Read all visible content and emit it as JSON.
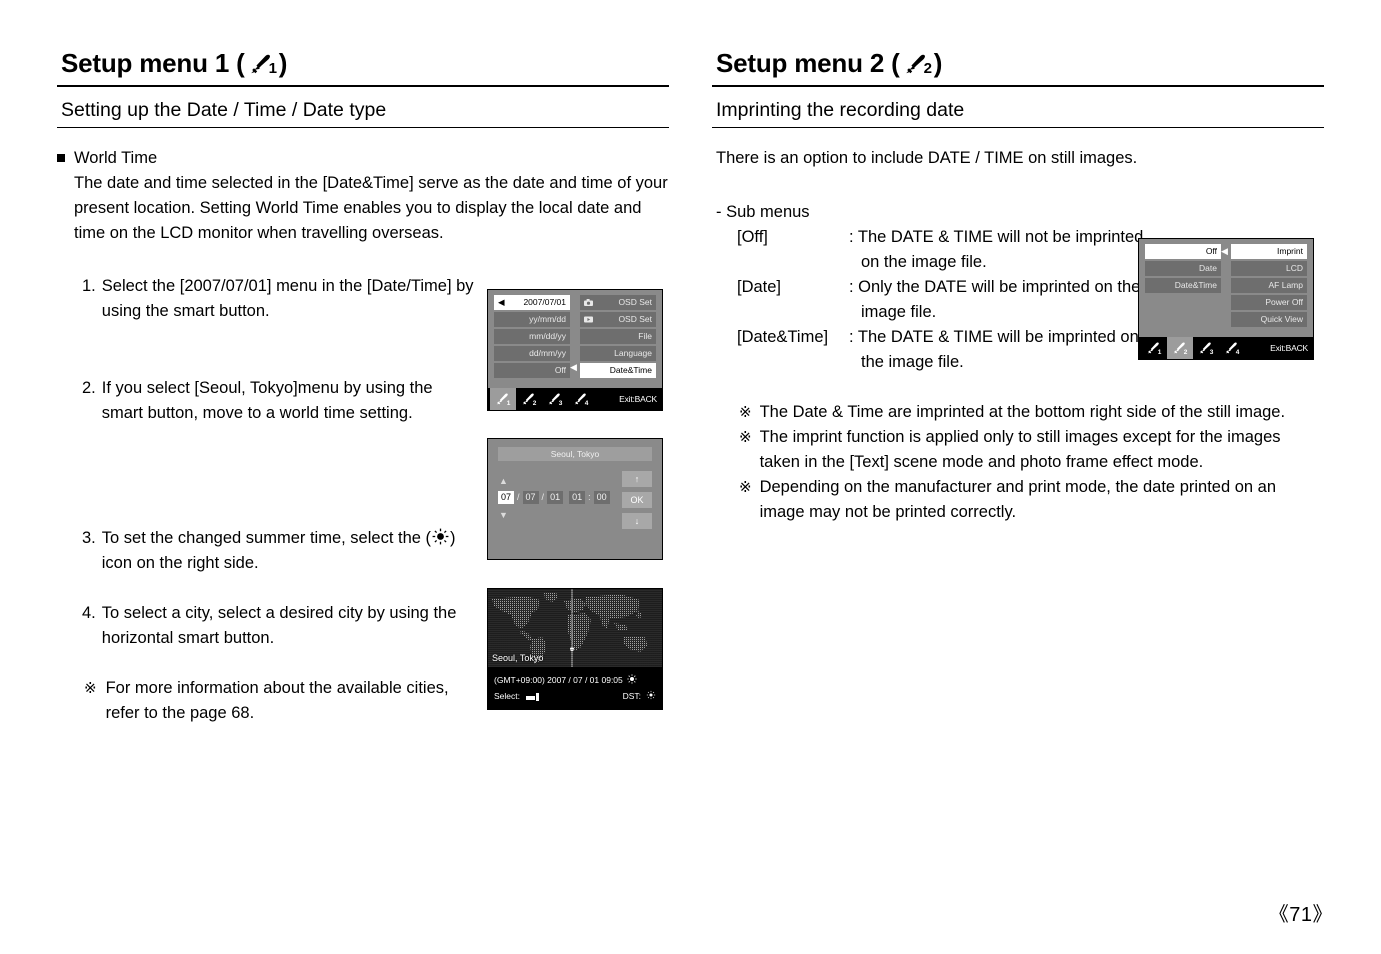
{
  "page": {
    "number": "《71》"
  },
  "left": {
    "chapter_title": "Setup menu 1 (",
    "chapter_title_close": ")",
    "wrench_sub": "1",
    "section_title": "Setting up the Date / Time / Date type",
    "bullet_heading": "World Time",
    "paragraph": "The date and time selected in the [Date&Time] serve as the date and time of your present location. Setting World Time enables you to display the local date and time on the LCD monitor when travelling overseas.",
    "steps": [
      {
        "num": "1.",
        "text": "Select the [2007/07/01] menu in the [Date/Time] by using the smart button."
      },
      {
        "num": "2.",
        "text": "If you select [Seoul, Tokyo]menu by using the smart button, move to a world time setting."
      },
      {
        "num": "3.",
        "text_before": "To set the changed summer time, select the (",
        "text_after": ") icon on the right side.",
        "icon": "sun-icon"
      },
      {
        "num": "4.",
        "text": "To select a city, select a desired city by using the horizontal smart button."
      }
    ],
    "note": {
      "mark": "※",
      "text": "For more information about the available cities, refer to the page 68."
    }
  },
  "right": {
    "chapter_title": "Setup menu 2 (",
    "chapter_title_close": ")",
    "wrench_sub": "2",
    "section_title": "Imprinting the recording date",
    "intro": "There is an option to include DATE / TIME on still images.",
    "submenus_label": "- Sub menus",
    "submenus": [
      {
        "key": "[Off]",
        "value": ": The DATE & TIME will not be imprinted",
        "cont": "on the image file."
      },
      {
        "key": "[Date]",
        "value": ": Only the DATE will be imprinted on the",
        "cont": "image file."
      },
      {
        "key": "[Date&Time]",
        "value": ": The DATE & TIME will be imprinted on",
        "cont": "the image file."
      }
    ],
    "notes": [
      {
        "mark": "※",
        "text": "The Date & Time are imprinted at the bottom right side of the still image."
      },
      {
        "mark": "※",
        "text": "The imprint function is applied only to still images except for the images taken in the [Text] scene mode and photo frame effect mode."
      },
      {
        "mark": "※",
        "text": "Depending on the manufacturer and print mode, the date printed on an image may not be printed correctly."
      }
    ]
  },
  "lcd_setup1": {
    "left_items": [
      {
        "label": "2007/07/01",
        "selected": true,
        "lead_arrow": "◀"
      },
      {
        "label": "yy/mm/dd",
        "selected": false
      },
      {
        "label": "mm/dd/yy",
        "selected": false
      },
      {
        "label": "dd/mm/yy",
        "selected": false
      },
      {
        "label": "Off",
        "selected": false
      }
    ],
    "right_items": [
      {
        "label": "OSD Set",
        "selected": false,
        "icon": "camera-icon"
      },
      {
        "label": "OSD Set",
        "selected": false,
        "icon": "play-icon"
      },
      {
        "label": "File",
        "selected": false
      },
      {
        "label": "Language",
        "selected": false
      },
      {
        "label": "Date&Time",
        "selected": true,
        "pointer": "◀"
      }
    ],
    "tabs": [
      {
        "sub": "1",
        "active": true
      },
      {
        "sub": "2",
        "active": false
      },
      {
        "sub": "3",
        "active": false
      },
      {
        "sub": "4",
        "active": false
      }
    ],
    "exit": "Exit:BACK"
  },
  "lcd_worldtime": {
    "city": "Seoul, Tokyo",
    "fields": [
      {
        "value": "07",
        "selected": true
      },
      {
        "value": "07",
        "selected": false
      },
      {
        "value": "01",
        "selected": false
      },
      {
        "value": "01",
        "selected": false
      },
      {
        "value": "00",
        "selected": false
      }
    ],
    "sep_slash": "/",
    "sep_colon": ":",
    "up_arrow": "▲",
    "down_arrow": "▼",
    "ok_label": "OK",
    "btn_up": "↑",
    "btn_down": "↓"
  },
  "lcd_map": {
    "city": "Seoul, Tokyo",
    "info": "(GMT+09:00) 2007 / 07 / 01 09:05",
    "select_label": "Select:",
    "dst_label": "DST:"
  },
  "lcd_setup2": {
    "left_items": [
      {
        "label": "Off",
        "selected": true
      },
      {
        "label": "Date",
        "selected": false
      },
      {
        "label": "Date&Time",
        "selected": false
      }
    ],
    "right_items": [
      {
        "label": "Imprint",
        "selected": true,
        "pointer": "◀"
      },
      {
        "label": "LCD",
        "selected": false
      },
      {
        "label": "AF Lamp",
        "selected": false
      },
      {
        "label": "Power Off",
        "selected": false
      },
      {
        "label": "Quick View",
        "selected": false
      }
    ],
    "tabs": [
      {
        "sub": "1",
        "active": false
      },
      {
        "sub": "2",
        "active": true
      },
      {
        "sub": "3",
        "active": false
      },
      {
        "sub": "4",
        "active": false
      }
    ],
    "exit": "Exit:BACK"
  },
  "colors": {
    "lcd_bg": "#8a8a8a",
    "item_bg": "#6e6e6e",
    "item_selected_bg": "#ffffff",
    "tabbar_bg": "#000000",
    "tab_active_bg": "#9c9c9c"
  }
}
